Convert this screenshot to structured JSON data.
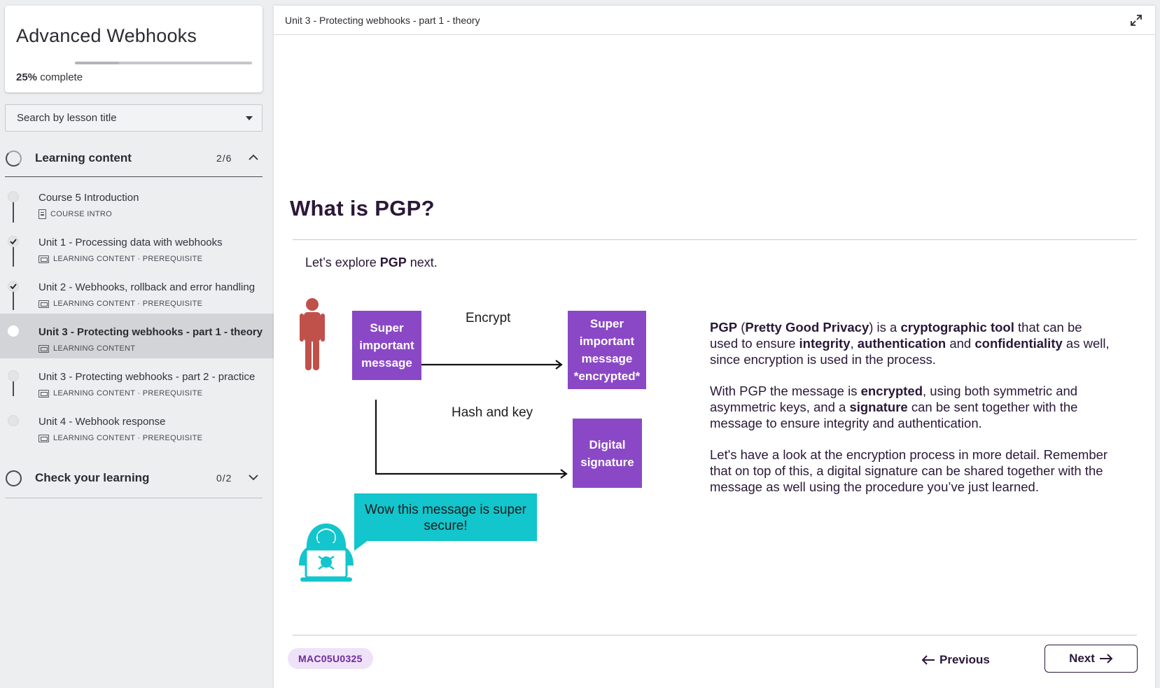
{
  "sidebar": {
    "course_title": "Advanced Webhooks",
    "progress_percent": 25,
    "progress_value": "25%",
    "progress_suffix": " complete",
    "search": {
      "label": "Search by lesson title"
    },
    "sections": [
      {
        "label": "Learning content",
        "count": "2/6",
        "expanded": true,
        "lessons": [
          {
            "title": "Course 5 Introduction",
            "meta": "COURSE INTRO",
            "status": "not-started"
          },
          {
            "title": "Unit 1 - Processing data with webhooks",
            "meta": "LEARNING CONTENT · PREREQUISITE",
            "status": "complete"
          },
          {
            "title": "Unit 2 - Webhooks, rollback and error handling",
            "meta": "LEARNING CONTENT · PREREQUISITE",
            "status": "complete"
          },
          {
            "title": "Unit 3 - Protecting webhooks - part 1 - theory",
            "meta": "LEARNING CONTENT",
            "status": "current"
          },
          {
            "title": "Unit 3 - Protecting webhooks - part 2 - practice",
            "meta": "LEARNING CONTENT · PREREQUISITE",
            "status": "not-started"
          },
          {
            "title": "Unit 4 - Webhook response",
            "meta": "LEARNING CONTENT · PREREQUISITE",
            "status": "not-started"
          }
        ]
      },
      {
        "label": "Check your learning",
        "count": "0/2",
        "expanded": false
      }
    ]
  },
  "main": {
    "breadcrumb": "Unit 3 - Protecting webhooks - part 1 - theory",
    "heading": "What is PGP?",
    "intro": {
      "before": "Let’s explore ",
      "bold": "PGP",
      "after": " next."
    },
    "diagram": {
      "source_box": "Super important message",
      "encrypt_label": "Encrypt",
      "encrypted_box": "Super important message *encrypted*",
      "hash_label": "Hash and key",
      "signature_box": "Digital signature",
      "bubble_text": "Wow this message is super secure!",
      "colors": {
        "box": "#8a48c6",
        "bubble": "#13c5cc",
        "person": "#c0504a",
        "hacker": "#13c5cc"
      }
    },
    "explanation": {
      "p1": [
        {
          "t": "PGP",
          "b": true
        },
        {
          "t": " (",
          "b": false
        },
        {
          "t": "Pretty Good Privacy",
          "b": true
        },
        {
          "t": ") is a ",
          "b": false
        },
        {
          "t": "cryptographic tool",
          "b": true
        },
        {
          "t": " that can be used to ensure ",
          "b": false
        },
        {
          "t": "integrity",
          "b": true
        },
        {
          "t": ", ",
          "b": false
        },
        {
          "t": "authentication",
          "b": true
        },
        {
          "t": " and ",
          "b": false
        },
        {
          "t": "confidentiality",
          "b": true
        },
        {
          "t": " as well, since encryption is used in the process.",
          "b": false
        }
      ],
      "p2": [
        {
          "t": "With PGP the message is ",
          "b": false
        },
        {
          "t": "encrypted",
          "b": true
        },
        {
          "t": ", using both symmetric and asymmetric keys, and a ",
          "b": false
        },
        {
          "t": "signature",
          "b": true
        },
        {
          "t": " can be sent together with the message to ensure integrity and authentication.",
          "b": false
        }
      ],
      "p3": "Let's have a look at the encryption process in more detail. Remember that on top of this, a digital signature can be shared together with the message as well using the procedure you’ve just learned."
    },
    "footer": {
      "code": "MAC05U0325",
      "previous_label": "Previous",
      "next_label": "Next"
    }
  }
}
